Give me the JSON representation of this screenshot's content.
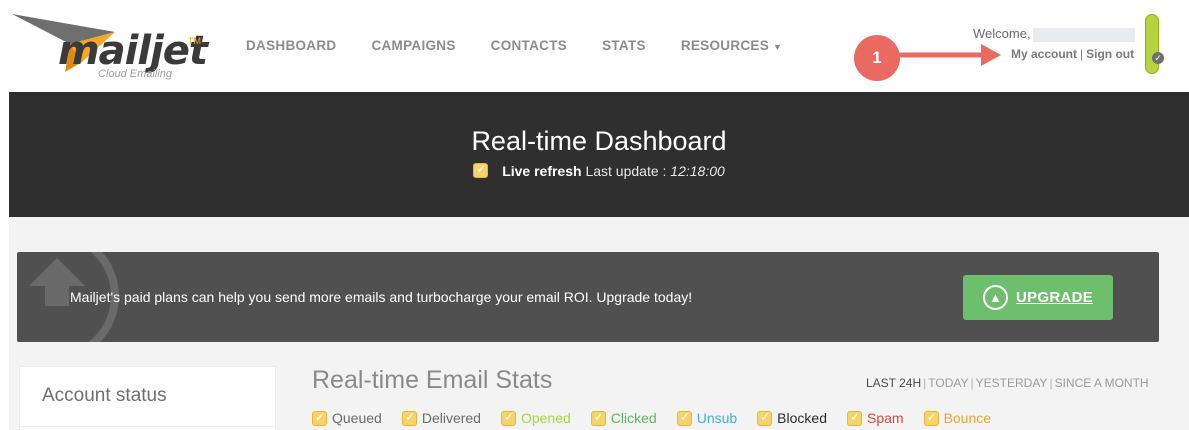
{
  "brand": {
    "logo_text": "mailjet",
    "logo_tm": "TM",
    "tagline": "Cloud Emailing"
  },
  "nav": {
    "items": [
      {
        "label": "DASHBOARD"
      },
      {
        "label": "CAMPAIGNS"
      },
      {
        "label": "CONTACTS"
      },
      {
        "label": "STATS"
      },
      {
        "label": "RESOURCES"
      }
    ]
  },
  "account": {
    "welcome": "Welcome,",
    "my_account": "My account",
    "separator": "|",
    "sign_out": "Sign out"
  },
  "annotation": {
    "number": "1"
  },
  "hero": {
    "title": "Real-time Dashboard",
    "live_refresh": "Live refresh",
    "last_update_label": "Last update :",
    "last_update_time": "12:18:00"
  },
  "upgrade": {
    "message": "Mailjet's paid plans can help you send more emails and turbocharge your email ROI. Upgrade today!",
    "button": "UPGRADE"
  },
  "sidebar": {
    "title": "Account status"
  },
  "stats": {
    "title": "Real-time Email Stats",
    "ranges": [
      {
        "label": "LAST 24H",
        "active": true
      },
      {
        "label": "TODAY"
      },
      {
        "label": "YESTERDAY"
      },
      {
        "label": "SINCE A MONTH"
      }
    ],
    "range_separator": "|",
    "filters": [
      {
        "label": "Queued",
        "color": "#6b6b6b",
        "checked": true
      },
      {
        "label": "Delivered",
        "color": "#6b6b6b",
        "checked": true
      },
      {
        "label": "Opened",
        "color": "#a6d63a",
        "checked": true
      },
      {
        "label": "Clicked",
        "color": "#5cb85c",
        "checked": true
      },
      {
        "label": "Unsub",
        "color": "#3bb3e0",
        "checked": true
      },
      {
        "label": "Blocked",
        "color": "#2b2b2b",
        "checked": true
      },
      {
        "label": "Spam",
        "color": "#e0453a",
        "checked": true
      },
      {
        "label": "Bounce",
        "color": "#f0a330",
        "checked": true
      }
    ]
  },
  "colors": {
    "hero_bg": "#2f2f2f",
    "banner_bg": "#505050",
    "upgrade_button": "#6dbf6d",
    "annotation_red": "#ea6a62",
    "checkbox_yellow": "#f7d36a"
  }
}
